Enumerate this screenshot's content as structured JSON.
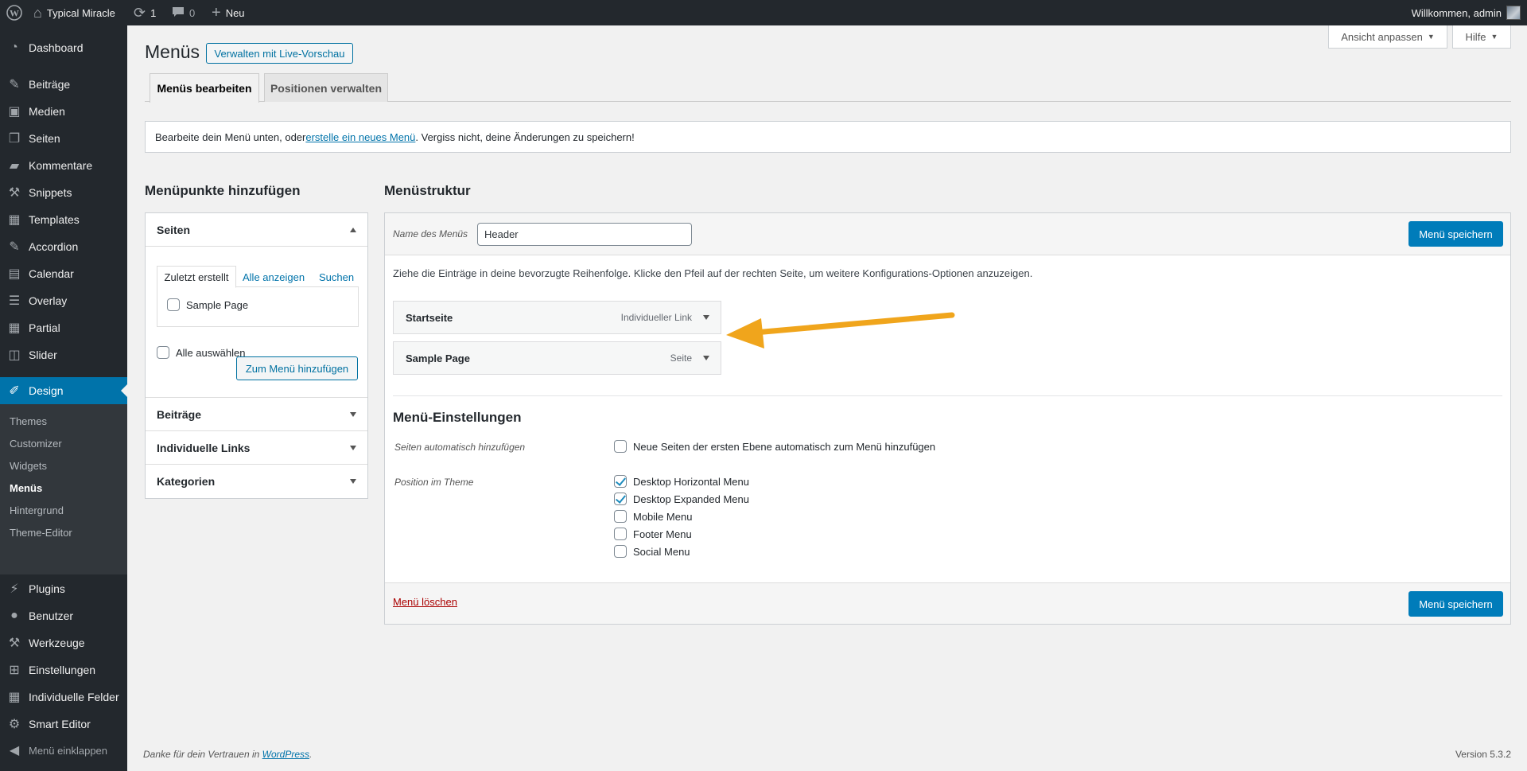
{
  "adminbar": {
    "site_name": "Typical Miracle",
    "updates_count": "1",
    "comments_count": "0",
    "new_label": "Neu",
    "welcome": "Willkommen, admin"
  },
  "sidebar": {
    "items": [
      {
        "label": "Dashboard",
        "icon": "dashboard-icon"
      },
      {
        "label": "Beiträge",
        "icon": "pin-icon"
      },
      {
        "label": "Medien",
        "icon": "media-icon"
      },
      {
        "label": "Seiten",
        "icon": "page-icon"
      },
      {
        "label": "Kommentare",
        "icon": "comment-icon"
      },
      {
        "label": "Snippets",
        "icon": "wrench-icon"
      },
      {
        "label": "Templates",
        "icon": "table-icon"
      },
      {
        "label": "Accordion",
        "icon": "pin-icon"
      },
      {
        "label": "Calendar",
        "icon": "calendar-icon"
      },
      {
        "label": "Overlay",
        "icon": "list-icon"
      },
      {
        "label": "Partial",
        "icon": "table-icon"
      },
      {
        "label": "Slider",
        "icon": "slider-icon"
      },
      {
        "label": "Design",
        "icon": "brush-icon"
      },
      {
        "label": "Plugins",
        "icon": "plugin-icon"
      },
      {
        "label": "Benutzer",
        "icon": "user-icon"
      },
      {
        "label": "Werkzeuge",
        "icon": "wrench-icon"
      },
      {
        "label": "Einstellungen",
        "icon": "settings-icon"
      },
      {
        "label": "Individuelle Felder",
        "icon": "table-icon"
      },
      {
        "label": "Smart Editor",
        "icon": "gear-icon"
      }
    ],
    "submenu": [
      "Themes",
      "Customizer",
      "Widgets",
      "Menüs",
      "Hintergrund",
      "Theme-Editor"
    ],
    "collapse_label": "Menü einklappen"
  },
  "header": {
    "title": "Menüs",
    "live_preview_button": "Verwalten mit Live-Vorschau",
    "screen_options": "Ansicht anpassen",
    "help": "Hilfe"
  },
  "tabs": [
    "Menüs bearbeiten",
    "Positionen verwalten"
  ],
  "notice": {
    "text_before": "Bearbeite dein Menü unten, oder ",
    "link": "erstelle ein neues Menü",
    "text_after": ". Vergiss nicht, deine Änderungen zu speichern!"
  },
  "add_items": {
    "heading": "Menüpunkte hinzufügen",
    "sections": [
      "Seiten",
      "Beiträge",
      "Individuelle Links",
      "Kategorien"
    ],
    "inner_tabs": [
      "Zuletzt erstellt",
      "Alle anzeigen",
      "Suchen"
    ],
    "pages": [
      "Sample Page"
    ],
    "select_all": "Alle auswählen",
    "add_button": "Zum Menü hinzufügen"
  },
  "structure": {
    "heading": "Menüstruktur",
    "name_label": "Name des Menüs",
    "name_value": "Header",
    "save_button": "Menü speichern",
    "instructions": "Ziehe die Einträge in deine bevorzugte Reihenfolge. Klicke den Pfeil auf der rechten Seite, um weitere Konfigurations-Optionen anzuzeigen.",
    "items": [
      {
        "title": "Startseite",
        "type": "Individueller Link"
      },
      {
        "title": "Sample Page",
        "type": "Seite"
      }
    ],
    "settings_heading": "Menü-Einstellungen",
    "auto_add_label": "Seiten automatisch hinzufügen",
    "auto_add_option": "Neue Seiten der ersten Ebene automatisch zum Menü hinzufügen",
    "position_label": "Position im Theme",
    "locations": [
      {
        "label": "Desktop Horizontal Menu",
        "checked": true
      },
      {
        "label": "Desktop Expanded Menu",
        "checked": true
      },
      {
        "label": "Mobile Menu",
        "checked": false
      },
      {
        "label": "Footer Menu",
        "checked": false
      },
      {
        "label": "Social Menu",
        "checked": false
      }
    ],
    "delete_link": "Menü löschen"
  },
  "footer": {
    "thanks_before": "Danke für dein Vertrauen in ",
    "thanks_link": "WordPress",
    "thanks_after": ".",
    "version": "Version 5.3.2"
  },
  "colors": {
    "admin_dark": "#23282d",
    "accent_blue": "#0073aa",
    "annotation_arrow": "#f0a51c",
    "delete_red": "#a00"
  }
}
